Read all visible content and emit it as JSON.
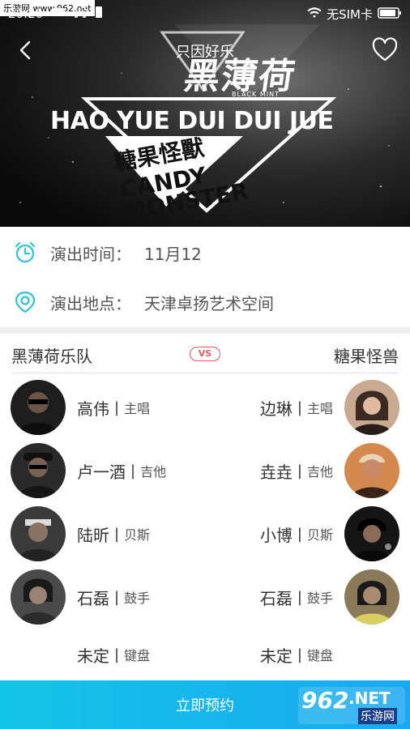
{
  "watermark": "乐游网 www.962.net",
  "status_bar": {
    "time": "20:20",
    "carrier": "无SIM卡"
  },
  "header": {
    "title": "只因好乐"
  },
  "poster": {
    "band_a_logo": "黑薄荷",
    "band_a_sub": "BLACK MINT",
    "banner": "HAO YUE DUI DUI JUE",
    "band_b_logo": "糖果怪獸",
    "band_b_sub": "CANDY MONSTER"
  },
  "info": {
    "time_label": "演出时间：",
    "time_value": "11月12",
    "place_label": "演出地点：",
    "place_value": "天津卓扬艺术空间"
  },
  "versus": {
    "left_band": "黑薄荷乐队",
    "badge": "VS",
    "right_band": "糖果怪兽"
  },
  "members_left": [
    {
      "name": "高伟",
      "sep": "|",
      "role": "主唱"
    },
    {
      "name": "卢一酒",
      "sep": "|",
      "role": "吉他"
    },
    {
      "name": "陆昕",
      "sep": "|",
      "role": "贝斯"
    },
    {
      "name": "石磊",
      "sep": "|",
      "role": "鼓手"
    },
    {
      "name": "未定",
      "sep": "|",
      "role": "键盘"
    }
  ],
  "members_right": [
    {
      "name": "边琳",
      "sep": "|",
      "role": "主唱"
    },
    {
      "name": "垚垚",
      "sep": "|",
      "role": "吉他"
    },
    {
      "name": "小博",
      "sep": "|",
      "role": "贝斯"
    },
    {
      "name": "石磊",
      "sep": "|",
      "role": "鼓手"
    },
    {
      "name": "未定",
      "sep": "|",
      "role": "键盘"
    }
  ],
  "book_button": "立即预约",
  "brand_badge": {
    "number": "962",
    "suffix": ".NET",
    "name": "乐游网"
  },
  "colors": {
    "accent": "#1ab4ec",
    "info_icon": "#2ec4d6",
    "vs": "#e45a6b"
  }
}
